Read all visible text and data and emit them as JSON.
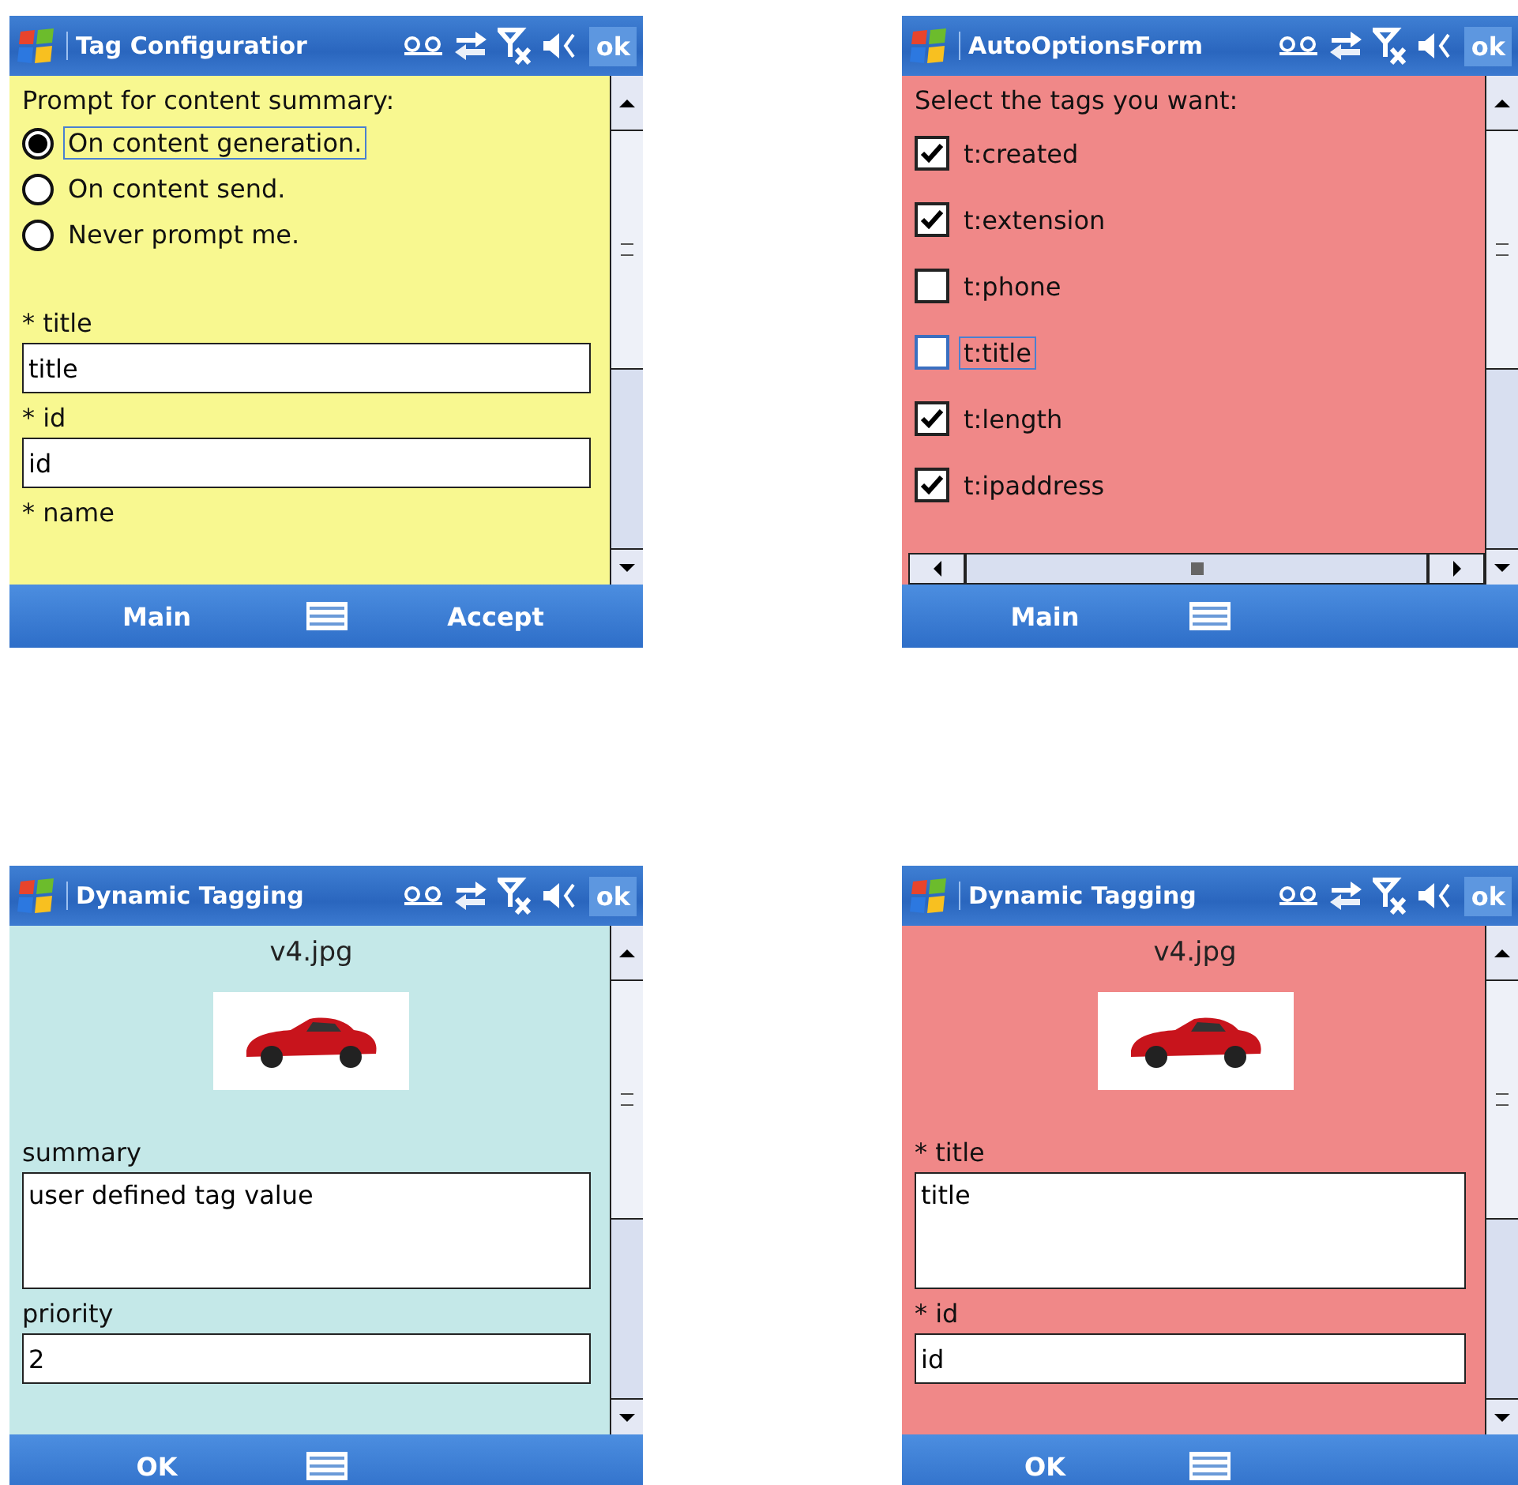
{
  "screens": [
    {
      "title": "Tag Configuratior",
      "ok": "ok",
      "color": "#f8f890",
      "horizontal_scrollbar": false,
      "items": [
        {
          "kind": "label",
          "text": "Prompt for content summary:"
        },
        {
          "kind": "radio",
          "text": "On content generation.",
          "selected": true,
          "focused": true
        },
        {
          "kind": "radio",
          "text": "On content send.",
          "selected": false,
          "focused": false
        },
        {
          "kind": "radio",
          "text": "Never prompt me.",
          "selected": false,
          "focused": false
        },
        {
          "kind": "spacer"
        },
        {
          "kind": "label",
          "text": "* title"
        },
        {
          "kind": "field",
          "value": "title"
        },
        {
          "kind": "label",
          "text": "* id"
        },
        {
          "kind": "field",
          "value": "id"
        },
        {
          "kind": "label",
          "text": "* name"
        }
      ],
      "softkeys": [
        "Main",
        "Accept"
      ]
    },
    {
      "title": "AutoOptionsForm",
      "ok": "ok",
      "color": "#f08888",
      "horizontal_scrollbar": true,
      "items": [
        {
          "kind": "label",
          "text": "Select the tags you want:"
        },
        {
          "kind": "checkbox",
          "text": "t:created",
          "checked": true,
          "focused": false
        },
        {
          "kind": "checkbox",
          "text": "t:extension",
          "checked": true,
          "focused": false
        },
        {
          "kind": "checkbox",
          "text": "t:phone",
          "checked": false,
          "focused": false
        },
        {
          "kind": "checkbox",
          "text": "t:title",
          "checked": false,
          "focused": true
        },
        {
          "kind": "checkbox",
          "text": "t:length",
          "checked": true,
          "focused": false
        },
        {
          "kind": "checkbox",
          "text": "t:ipaddress",
          "checked": true,
          "focused": false
        }
      ],
      "softkeys": [
        "Main"
      ]
    },
    {
      "title": "Dynamic Tagging",
      "ok": "ok",
      "color": "#c4e8e8",
      "horizontal_scrollbar": false,
      "items": [
        {
          "kind": "caption",
          "text": "v4.jpg"
        },
        {
          "kind": "image"
        },
        {
          "kind": "label",
          "text": "summary"
        },
        {
          "kind": "textarea",
          "value": "user defined tag value"
        },
        {
          "kind": "label",
          "text": "priority"
        },
        {
          "kind": "field",
          "value": "2"
        }
      ],
      "softkeys": [
        "OK"
      ]
    },
    {
      "title": "Dynamic Tagging",
      "ok": "ok",
      "color": "#f08888",
      "horizontal_scrollbar": false,
      "items": [
        {
          "kind": "caption",
          "text": "v4.jpg"
        },
        {
          "kind": "image"
        },
        {
          "kind": "label",
          "text": "* title"
        },
        {
          "kind": "textarea",
          "value": "title"
        },
        {
          "kind": "label",
          "text": "* id"
        },
        {
          "kind": "field",
          "value": "id"
        }
      ],
      "softkeys": [
        "OK"
      ]
    }
  ]
}
